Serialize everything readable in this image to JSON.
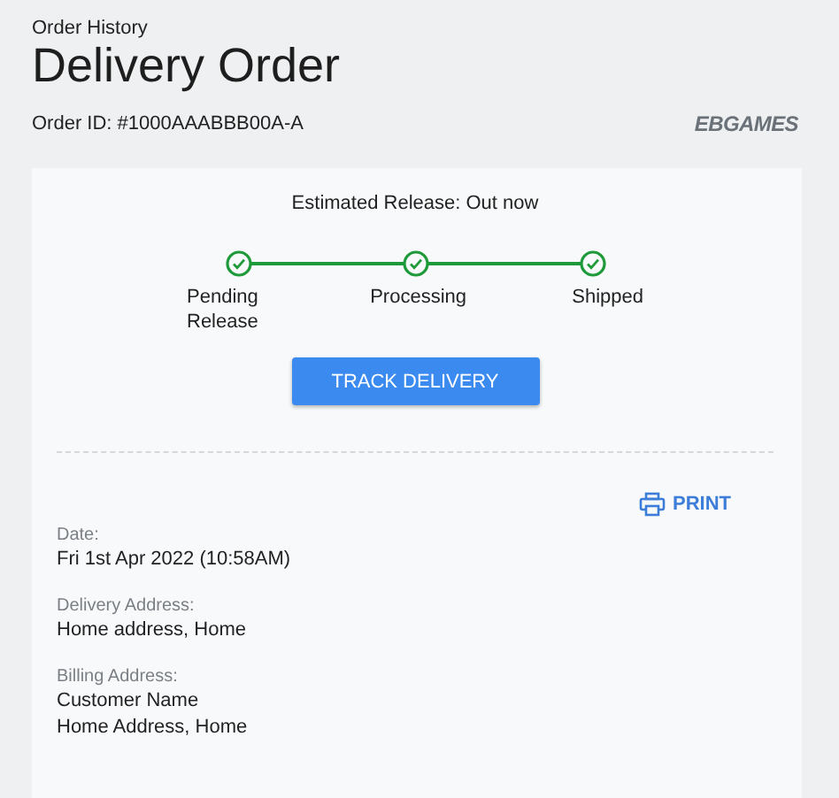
{
  "breadcrumb": "Order History",
  "title": "Delivery Order",
  "order_id": "Order ID: #1000AAABBB00A-A",
  "logo": "EBGAMES",
  "release": "Estimated Release: Out now",
  "steps": [
    {
      "label": "Pending Release",
      "done": true
    },
    {
      "label": "Processing",
      "done": true
    },
    {
      "label": "Shipped",
      "done": true
    }
  ],
  "track_button": "TRACK DELIVERY",
  "print_button": "PRINT",
  "details": [
    {
      "label": "Date:",
      "lines": [
        "Fri 1st Apr 2022 (10:58AM)"
      ]
    },
    {
      "label": "Delivery Address:",
      "lines": [
        "Home address, Home"
      ]
    },
    {
      "label": "Billing Address:",
      "lines": [
        "Customer Name",
        "Home Address, Home"
      ]
    }
  ]
}
